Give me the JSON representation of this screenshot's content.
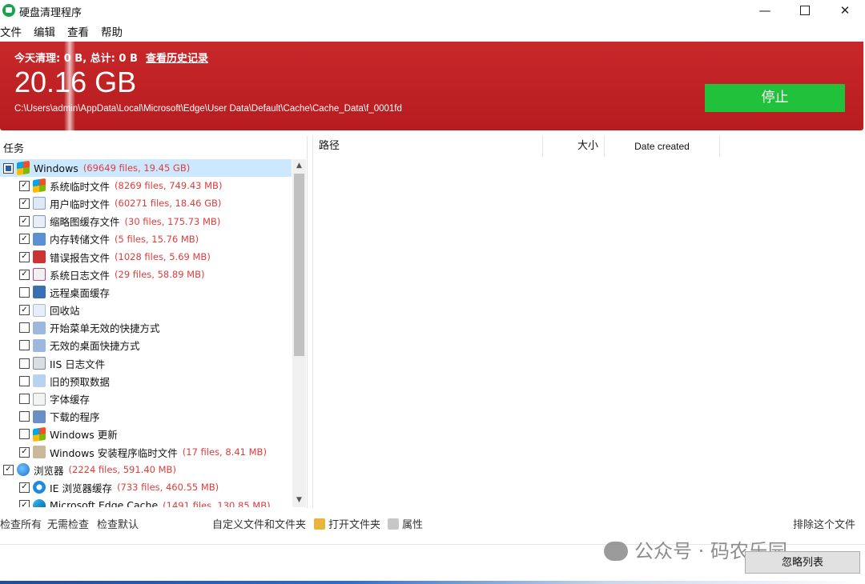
{
  "window": {
    "title": "硬盘清理程序",
    "minimize": "—",
    "close": "✕"
  },
  "menu": [
    "文件",
    "编辑",
    "查看",
    "帮助"
  ],
  "banner": {
    "stats": "今天清理: 0 B, 总计: 0 B",
    "history_link": "查看历史记录",
    "size": "20.16 GB",
    "current_path": "C:\\Users\\admin\\AppData\\Local\\Microsoft\\Edge\\User Data\\Default\\Cache\\Cache_Data\\f_0001fd",
    "stop_button": "停止",
    "colors": {
      "header_red": "#c8282a",
      "stop_green": "#22c13b",
      "count_red": "#e03c3c"
    }
  },
  "tasks": {
    "header": "任务",
    "items": [
      {
        "level": 0,
        "icon": "windows-icon",
        "cb": "partial",
        "label": "Windows",
        "count": "(69649 files, 19.45 GB)",
        "selected": true
      },
      {
        "level": 1,
        "icon": "windows-icon",
        "cb": "checked",
        "label": "系统临时文件",
        "count": "(8269 files, 749.43 MB)"
      },
      {
        "level": 1,
        "icon": "document-icon",
        "cb": "checked",
        "label": "用户临时文件",
        "count": "(60271 files, 18.46 GB)"
      },
      {
        "level": 1,
        "icon": "thumbnail-icon",
        "cb": "checked",
        "label": "缩略图缓存文件",
        "count": "(30 files, 175.73 MB)"
      },
      {
        "level": 1,
        "icon": "memory-dump-icon",
        "cb": "checked",
        "label": "内存转储文件",
        "count": "(5 files, 15.76 MB)"
      },
      {
        "level": 1,
        "icon": "error-report-icon",
        "cb": "checked",
        "label": "错误报告文件",
        "count": "(1028 files, 5.69 MB)"
      },
      {
        "level": 1,
        "icon": "system-log-icon",
        "cb": "checked",
        "label": "系统日志文件",
        "count": "(29 files, 58.89 MB)"
      },
      {
        "level": 1,
        "icon": "remote-desktop-icon",
        "cb": "unchecked",
        "label": "远程桌面缓存",
        "count": ""
      },
      {
        "level": 1,
        "icon": "recycle-bin-icon",
        "cb": "checked",
        "label": "回收站",
        "count": ""
      },
      {
        "level": 1,
        "icon": "shortcut-icon",
        "cb": "unchecked",
        "label": "开始菜单无效的快捷方式",
        "count": ""
      },
      {
        "level": 1,
        "icon": "shortcut-icon",
        "cb": "unchecked",
        "label": "无效的桌面快捷方式",
        "count": ""
      },
      {
        "level": 1,
        "icon": "iis-log-icon",
        "cb": "unchecked",
        "label": "IIS 日志文件",
        "count": ""
      },
      {
        "level": 1,
        "icon": "prefetch-icon",
        "cb": "unchecked",
        "label": "旧的预取数据",
        "count": ""
      },
      {
        "level": 1,
        "icon": "font-cache-icon",
        "cb": "unchecked",
        "label": "字体缓存",
        "count": ""
      },
      {
        "level": 1,
        "icon": "download-icon",
        "cb": "unchecked",
        "label": "下载的程序",
        "count": ""
      },
      {
        "level": 1,
        "icon": "windows-update-icon",
        "cb": "unchecked",
        "label": "Windows 更新",
        "count": ""
      },
      {
        "level": 1,
        "icon": "installer-icon",
        "cb": "checked",
        "label": "Windows 安装程序临时文件",
        "count": "(17 files, 8.41 MB)"
      },
      {
        "level": 0,
        "icon": "globe-icon",
        "cb": "checked",
        "label": "浏览器",
        "count": "(2224 files, 591.40 MB)"
      },
      {
        "level": 1,
        "icon": "ie-icon",
        "cb": "checked",
        "label": "IE 浏览器缓存",
        "count": "(733 files, 460.55 MB)"
      },
      {
        "level": 1,
        "icon": "edge-icon",
        "cb": "checked",
        "label": "Microsoft Edge Cache",
        "count": "(1491 files, 130.85 MB)"
      }
    ]
  },
  "results": {
    "columns": {
      "path": "路径",
      "size": "大小",
      "date": "Date created"
    }
  },
  "toolbar": {
    "check_all": "检查所有",
    "no_check": "无需检查",
    "check_default": "检查默认",
    "custom_folders": "自定义文件和文件夹",
    "open_folder": "打开文件夹",
    "properties": "属性",
    "exclude_file": "排除这个文件",
    "ignore_list": "忽略列表"
  },
  "watermark": {
    "text": "公众号 · 码农乐园"
  }
}
